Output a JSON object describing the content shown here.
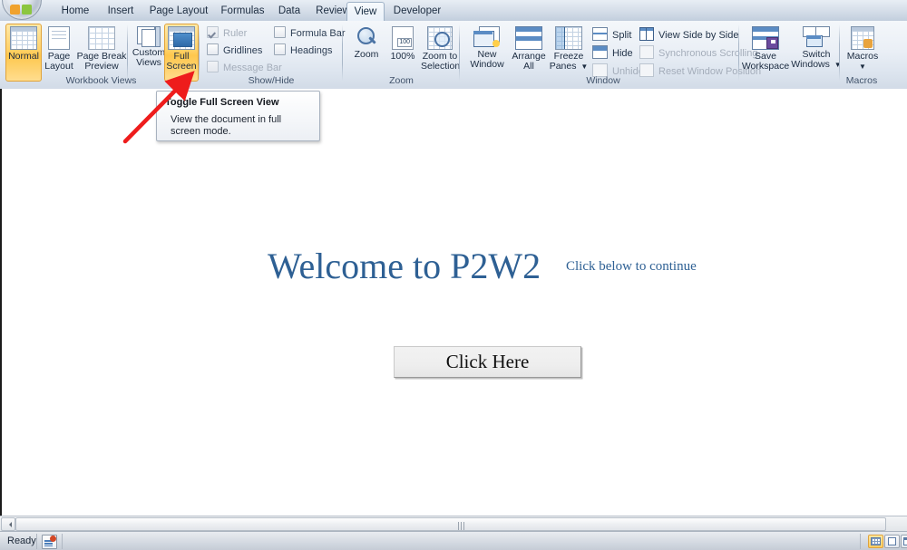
{
  "app": {
    "office_orb": "office-orb",
    "tabs": [
      {
        "label": "Home",
        "active": false
      },
      {
        "label": "Insert",
        "active": false
      },
      {
        "label": "Page Layout",
        "active": false
      },
      {
        "label": "Formulas",
        "active": false
      },
      {
        "label": "Data",
        "active": false
      },
      {
        "label": "Review",
        "active": false
      },
      {
        "label": "View",
        "active": true
      },
      {
        "label": "Developer",
        "active": false
      }
    ]
  },
  "ribbon": {
    "groups": [
      {
        "name": "workbook-views",
        "label": "Workbook Views"
      },
      {
        "name": "show-hide",
        "label": "Show/Hide"
      },
      {
        "name": "zoom",
        "label": "Zoom"
      },
      {
        "name": "window",
        "label": "Window"
      },
      {
        "name": "macros",
        "label": "Macros"
      }
    ],
    "workbook_views": {
      "normal": {
        "line1": "Normal",
        "line2": "",
        "selected": true
      },
      "page_layout": {
        "line1": "Page",
        "line2": "Layout",
        "selected": false
      },
      "page_break_preview": {
        "line1": "Page Break",
        "line2": "Preview",
        "selected": false
      },
      "custom_views": {
        "line1": "Custom",
        "line2": "Views",
        "selected": false
      },
      "full_screen": {
        "line1": "Full",
        "line2": "Screen",
        "selected": true
      }
    },
    "show_hide": {
      "ruler": {
        "label": "Ruler",
        "checked": true,
        "disabled": true
      },
      "gridlines": {
        "label": "Gridlines",
        "checked": false,
        "disabled": false
      },
      "message_bar": {
        "label": "Message Bar",
        "checked": false,
        "disabled": true
      },
      "formula_bar": {
        "label": "Formula Bar",
        "checked": false,
        "disabled": false
      },
      "headings": {
        "label": "Headings",
        "checked": false,
        "disabled": false
      }
    },
    "zoom_group": {
      "zoom": {
        "line1": "Zoom",
        "line2": ""
      },
      "hundred": {
        "line1": "100%",
        "line2": ""
      },
      "zoom_to_selection": {
        "line1": "Zoom to",
        "line2": "Selection"
      }
    },
    "window_group": {
      "new_window": {
        "line1": "New",
        "line2": "Window"
      },
      "arrange_all": {
        "line1": "Arrange",
        "line2": "All"
      },
      "freeze_panes": {
        "line1": "Freeze",
        "line2": "Panes"
      },
      "split": {
        "label": "Split",
        "disabled": false
      },
      "hide": {
        "label": "Hide",
        "disabled": false
      },
      "unhide": {
        "label": "Unhide",
        "disabled": true
      },
      "view_side_by_side": {
        "label": "View Side by Side",
        "disabled": false
      },
      "synchronous_scrolling": {
        "label": "Synchronous Scrolling",
        "disabled": true
      },
      "reset_window_position": {
        "label": "Reset Window Position",
        "disabled": true
      },
      "save_workspace": {
        "line1": "Save",
        "line2": "Workspace"
      },
      "switch_windows": {
        "line1": "Switch",
        "line2": "Windows"
      }
    },
    "macros_group": {
      "macros": {
        "line1": "Macros",
        "line2": ""
      }
    }
  },
  "tooltip": {
    "title": "Toggle Full Screen View",
    "body": "View the document in full screen mode."
  },
  "annotation": {
    "arrow_color": "#ee1c1c",
    "points_to": "full-screen-button"
  },
  "sheet": {
    "welcome_title": "Welcome to P2W2",
    "subtitle": "Click below to continue",
    "click_button": "Click Here",
    "title_color": "#2e6094"
  },
  "statusbar": {
    "ready": "Ready",
    "views": [
      {
        "name": "normal-view",
        "selected": true
      },
      {
        "name": "page-layout-view",
        "selected": false
      },
      {
        "name": "page-break-preview-view",
        "selected": false
      }
    ]
  }
}
